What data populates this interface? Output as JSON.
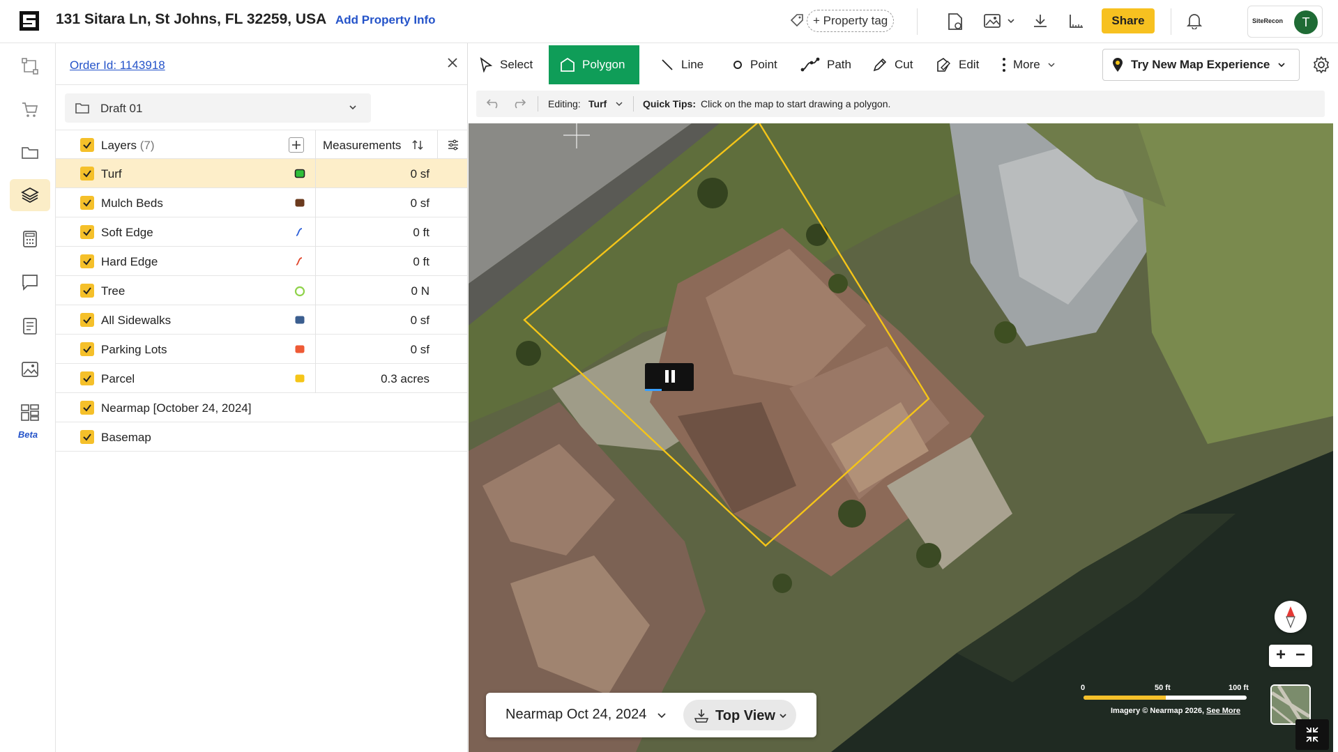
{
  "header": {
    "address": "131 Sitara Ln, St Johns, FL 32259, USA",
    "add_property_info": "Add Property Info",
    "property_tag": "+ Property tag",
    "share": "Share",
    "org_logo": "SiteRecon",
    "avatar_initial": "T"
  },
  "nav": {
    "beta_label": "Beta",
    "items": [
      "workflow",
      "cart",
      "folder",
      "layers",
      "calculator",
      "chat",
      "notes",
      "image",
      "beta-tool"
    ],
    "active": "layers"
  },
  "panel": {
    "order_id": "Order Id: 1143918",
    "draft": "Draft 01",
    "header": {
      "layers_label": "Layers",
      "layers_count": "(7)",
      "measurements_label": "Measurements"
    },
    "layers": [
      {
        "name": "Turf",
        "value": "0 sf",
        "color": "#2fbf3a",
        "highlighted": true
      },
      {
        "name": "Mulch Beds",
        "value": "0 sf",
        "color": "#6b3a1e"
      },
      {
        "name": "Soft Edge",
        "value": "0 ft",
        "color": "#2d5fd8"
      },
      {
        "name": "Hard Edge",
        "value": "0 ft",
        "color": "#e0452b"
      },
      {
        "name": "Tree",
        "value": "0 N",
        "color": "#8fd24a"
      },
      {
        "name": "All Sidewalks",
        "value": "0 sf",
        "color": "#3b5e8f"
      },
      {
        "name": "Parking Lots",
        "value": "0 sf",
        "color": "#ee5a35"
      },
      {
        "name": "Parcel",
        "value": "0.3 acres",
        "color": "#f5c518"
      }
    ],
    "base_layers": [
      {
        "name": "Nearmap",
        "suffix": "[October 24, 2024]"
      },
      {
        "name": "Basemap"
      }
    ]
  },
  "toolbar": {
    "tools": [
      {
        "label": "Select",
        "icon": "cursor-icon"
      },
      {
        "label": "Polygon",
        "icon": "polygon-icon",
        "active": true
      },
      {
        "label": "Line",
        "icon": "line-icon"
      },
      {
        "label": "Point",
        "icon": "point-icon"
      },
      {
        "label": "Path",
        "icon": "path-icon"
      },
      {
        "label": "Cut",
        "icon": "pen-icon"
      },
      {
        "label": "Edit",
        "icon": "edit-polygon-icon"
      },
      {
        "label": "More",
        "icon": "more-icon"
      }
    ],
    "map_experience": "Try New Map Experience"
  },
  "editbar": {
    "editing_label": "Editing:",
    "editing_layer": "Turf",
    "quick_tips_label": "Quick Tips:",
    "tip": "Click on the map to start drawing a polygon."
  },
  "map": {
    "imagery_date": "Nearmap Oct 24, 2024",
    "view": "Top View",
    "scale": {
      "start": "0",
      "mid": "50 ft",
      "end": "100 ft"
    },
    "credit_prefix": "Imagery © Nearmap 2026,",
    "credit_link": "See More",
    "parcel_color": "#f5c518"
  }
}
